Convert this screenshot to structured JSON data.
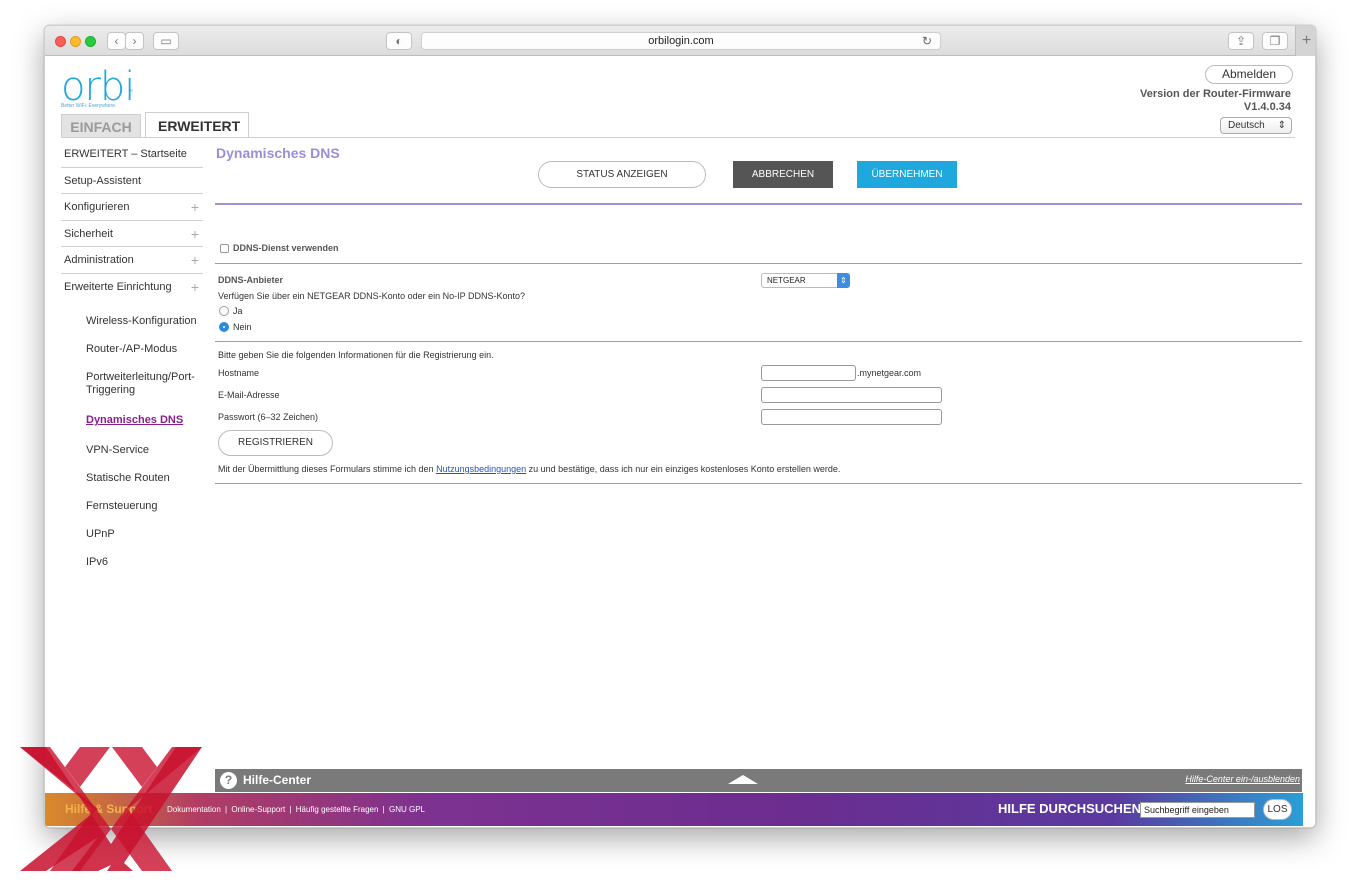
{
  "browser": {
    "url": "orbilogin.com"
  },
  "header": {
    "logo": "orbi",
    "logo_tm": "™",
    "tagline": "Better WiFi. Everywhere.",
    "tab_basic": "EINFACH",
    "tab_advanced": "ERWEITERT",
    "logout": "Abmelden",
    "firmware_label": "Version der Router-Firmware",
    "firmware_version": "V1.4.0.34",
    "language": "Deutsch"
  },
  "sidebar": {
    "items": [
      {
        "label": "ERWEITERT – Startseite",
        "plus": false
      },
      {
        "label": "Setup-Assistent",
        "plus": false
      },
      {
        "label": "Konfigurieren",
        "plus": true
      },
      {
        "label": "Sicherheit",
        "plus": true
      },
      {
        "label": "Administration",
        "plus": true
      },
      {
        "label": "Erweiterte Einrichtung",
        "plus": true
      }
    ],
    "sub_items": [
      "Wireless-Konfiguration",
      "Router-/AP-Modus",
      "Portweiterleitung/Port-Triggering",
      "Dynamisches DNS",
      "VPN-Service",
      "Statische Routen",
      "Fernsteuerung",
      "UPnP",
      "IPv6"
    ],
    "active_sub": "Dynamisches DNS"
  },
  "content": {
    "title": "Dynamisches DNS",
    "btn_status": "STATUS ANZEIGEN",
    "btn_cancel": "ABBRECHEN",
    "btn_apply": "ÜBERNEHMEN",
    "use_ddns_label": "DDNS-Dienst verwenden",
    "provider_label": "DDNS-Anbieter",
    "provider_value": "NETGEAR",
    "account_question": "Verfügen Sie über ein NETGEAR DDNS-Konto oder ein No-IP DDNS-Konto?",
    "radio_yes": "Ja",
    "radio_no": "Nein",
    "register_intro": "Bitte geben Sie die folgenden Informationen für die Registrierung ein.",
    "hostname_label": "Hostname",
    "hostname_suffix": ".mynetgear.com",
    "email_label": "E-Mail-Adresse",
    "password_label": "Passwort (6–32 Zeichen)",
    "btn_register": "REGISTRIEREN",
    "terms_prefix": "Mit der Übermittlung dieses Formulars stimme ich den ",
    "terms_link": "Nutzungsbedingungen",
    "terms_suffix": " zu und bestätige, dass ich nur ein einziges kostenloses Konto erstellen werde."
  },
  "helpbar": {
    "title": "Hilfe-Center",
    "toggle": "Hilfe-Center ein-/ausblenden"
  },
  "footer": {
    "title": "Hilfe & Support",
    "links": [
      "Dokumentation",
      "Online-Support",
      "Häufig gestellte Fragen",
      "GNU GPL"
    ],
    "separator": "|",
    "search_title": "HILFE DURCHSUCHEN",
    "search_placeholder": "Suchbegriff eingeben",
    "search_button": "LOS"
  },
  "colors": {
    "brand_blue": "#1ea8de",
    "title_purple": "#9a8fd6",
    "active_nav": "#8b1e8f",
    "cancel_gray": "#555555",
    "watermark_red": "#c8102e"
  },
  "icons": [
    "back-icon",
    "forward-icon",
    "sidebar-toggle-icon",
    "reader-icon",
    "reload-icon",
    "share-icon",
    "tabs-icon",
    "help-icon",
    "collapse-arrow-icon"
  ]
}
